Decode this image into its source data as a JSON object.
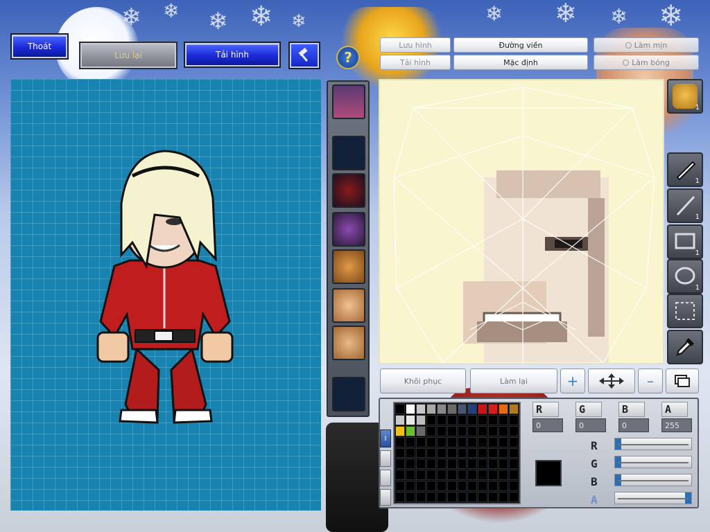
{
  "top_bar": {
    "exit_label": "Thoát",
    "save_label": "Lưu lại",
    "reload_label": "Tải hình",
    "hammer_icon": "hammer-icon"
  },
  "editor_bar": {
    "help_icon": "question-mark-icon",
    "save_image_label": "Lưu hình",
    "load_image_label": "Tải hình",
    "outline_label": "Đường viền",
    "default_label": "Mặc định",
    "smooth_label": "Làm mịn",
    "shine_label": "Làm bóng"
  },
  "tools": [
    {
      "name": "face-icon",
      "count": "1"
    },
    {
      "name": "pen-icon",
      "count": "1"
    },
    {
      "name": "line-icon",
      "count": "1"
    },
    {
      "name": "rectangle-icon",
      "count": "1"
    },
    {
      "name": "ellipse-icon",
      "count": "1"
    },
    {
      "name": "select-icon",
      "count": ""
    },
    {
      "name": "eyedropper-icon",
      "count": ""
    }
  ],
  "actions": {
    "restore_label": "Khôi phục",
    "redo_label": "Làm lại",
    "zoom_in_icon": "plus-icon",
    "move_icon": "move-arrows-icon",
    "zoom_out_icon": "minus-icon",
    "layers_icon": "layers-icon"
  },
  "color_picker": {
    "r_label": "R",
    "g_label": "G",
    "b_label": "B",
    "a_label": "A",
    "r_value": "0",
    "g_value": "0",
    "b_value": "0",
    "a_value": "255",
    "current_color": "#000000",
    "side_tab_label": "I",
    "swatches": [
      "#000000",
      "#ffffff",
      "#c8c8c8",
      "#a8a8a8",
      "#888888",
      "#6a6a6a",
      "#4a5670",
      "#24407a",
      "#c81414",
      "#d61e1e",
      "#e86a10",
      "#b07a20",
      "#c9c9c9",
      "#e8e8e8",
      "#bdbdbd",
      "#000000",
      "#000000",
      "#000000",
      "#000000",
      "#000000",
      "#000000",
      "#000000",
      "#000000",
      "#000000",
      "#f2c10f",
      "#6fbf2a",
      "#6a6a6a"
    ],
    "sliders": {
      "r": 0.0,
      "g": 0.0,
      "b": 0.0,
      "a": 1.0
    }
  }
}
